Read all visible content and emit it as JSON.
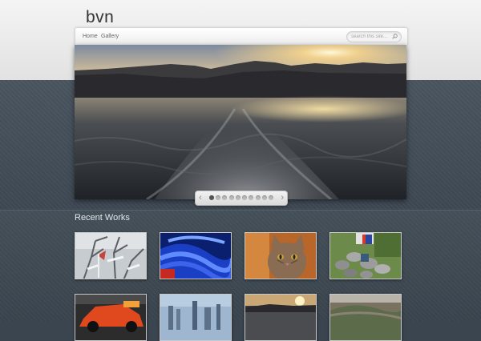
{
  "site": {
    "logo": "bvn"
  },
  "nav": {
    "items": [
      {
        "label": "Home"
      },
      {
        "label": "Gallery"
      }
    ],
    "search_placeholder": "search this site..."
  },
  "slider": {
    "slide_count": 10,
    "active_index": 0,
    "prev_glyph": "‹",
    "next_glyph": "›"
  },
  "recent_works": {
    "title": "Recent Works",
    "items": [
      {
        "icon": "frost-branches-photo"
      },
      {
        "icon": "blue-abstract-photo"
      },
      {
        "icon": "cat-photo"
      },
      {
        "icon": "rock-fountain-photo"
      },
      {
        "icon": "red-sports-car-photo"
      },
      {
        "icon": "city-skyline-photo"
      },
      {
        "icon": "sunset-lake-photo"
      },
      {
        "icon": "aerial-landscape-photo"
      }
    ]
  }
}
